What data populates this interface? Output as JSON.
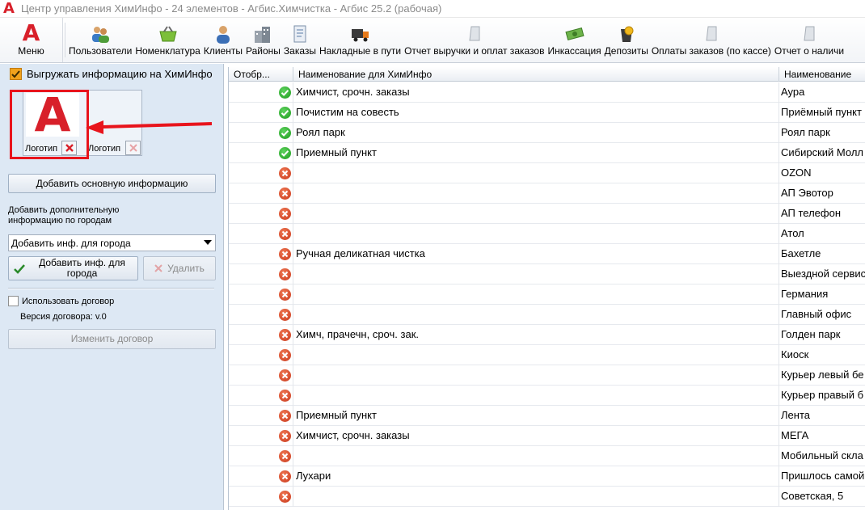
{
  "window": {
    "app_glyph": "A",
    "title": "Центр управления ХимИнфо - 24 элементов - Агбис.Химчистка - Агбис 25.2 (рабочая)"
  },
  "toolbar": {
    "menu": {
      "glyph": "A",
      "label": "Меню"
    },
    "items": [
      {
        "label": "Пользователи",
        "icon": "users-icon"
      },
      {
        "label": "Номенклатура",
        "icon": "basket-icon"
      },
      {
        "label": "Клиенты",
        "icon": "client-icon"
      },
      {
        "label": "Районы",
        "icon": "buildings-icon"
      },
      {
        "label": "Заказы",
        "icon": "orders-icon"
      },
      {
        "label": "Накладные в пути",
        "icon": "truck-icon"
      },
      {
        "label": "Отчет выручки и оплат заказов",
        "icon": "report-icon"
      },
      {
        "label": "Инкассация",
        "icon": "money-icon"
      },
      {
        "label": "Депозиты",
        "icon": "coins-icon"
      },
      {
        "label": "Оплаты заказов (по кассе)",
        "icon": "report-icon"
      },
      {
        "label": "Отчет о наличи",
        "icon": "report-icon"
      }
    ]
  },
  "left": {
    "upload_checkbox": {
      "label": "Выгружать информацию на ХимИнфо",
      "checked": true
    },
    "logos": [
      {
        "glyph": "A",
        "caption": "Логотип"
      },
      {
        "glyph": "",
        "caption": "Логотип"
      }
    ],
    "add_main_button": "Добавить основную информацию",
    "add_city_caption": "Добавить дополнительную информацию по городам",
    "city_combo_value": "Добавить инф. для города",
    "add_city_button": "Добавить инф. для города",
    "delete_button": "Удалить",
    "use_contract": {
      "label": "Использовать договор",
      "checked": false
    },
    "contract_version": "Версия договора: v.0",
    "change_contract_button": "Изменить договор"
  },
  "grid": {
    "columns": [
      "Отобр...",
      "Наименование для ХимИнфо",
      "Наименование"
    ],
    "rows": [
      {
        "status": "ok",
        "himinfo_name": "Химчист, срочн. заказы",
        "name": "Аура"
      },
      {
        "status": "ok",
        "himinfo_name": "Почистим на совесть",
        "name": "Приёмный пункт"
      },
      {
        "status": "ok",
        "himinfo_name": "Роял парк",
        "name": "Роял парк"
      },
      {
        "status": "ok",
        "himinfo_name": "Приемный пункт",
        "name": "Сибирский Молл"
      },
      {
        "status": "no",
        "himinfo_name": "",
        "name": "OZON"
      },
      {
        "status": "no",
        "himinfo_name": "",
        "name": "АП Эвотор"
      },
      {
        "status": "no",
        "himinfo_name": "",
        "name": "АП телефон"
      },
      {
        "status": "no",
        "himinfo_name": "",
        "name": "Атол"
      },
      {
        "status": "no",
        "himinfo_name": "Ручная деликатная чистка",
        "name": "Бахетле"
      },
      {
        "status": "no",
        "himinfo_name": "",
        "name": "Выездной сервис"
      },
      {
        "status": "no",
        "himinfo_name": "",
        "name": "Германия"
      },
      {
        "status": "no",
        "himinfo_name": "",
        "name": "Главный офис"
      },
      {
        "status": "no",
        "himinfo_name": "Химч, прачечн, сроч. зак.",
        "name": "Голден парк"
      },
      {
        "status": "no",
        "himinfo_name": "",
        "name": "Киоск"
      },
      {
        "status": "no",
        "himinfo_name": "",
        "name": "Курьер левый бе"
      },
      {
        "status": "no",
        "himinfo_name": "",
        "name": "Курьер правый б"
      },
      {
        "status": "no",
        "himinfo_name": "Приемный пункт",
        "name": "Лента"
      },
      {
        "status": "no",
        "himinfo_name": "Химчист, срочн. заказы",
        "name": "МЕГА"
      },
      {
        "status": "no",
        "himinfo_name": "",
        "name": "Мобильный скла"
      },
      {
        "status": "no",
        "himinfo_name": "Лухари",
        "name": "Пришлось самой"
      },
      {
        "status": "no",
        "himinfo_name": "",
        "name": "Советская, 5"
      }
    ]
  },
  "colors": {
    "accent": "#d8202a",
    "ok": "#1d9a1d",
    "error": "#c8361a",
    "panel": "#dde8f4",
    "highlight": "#e8141c"
  }
}
